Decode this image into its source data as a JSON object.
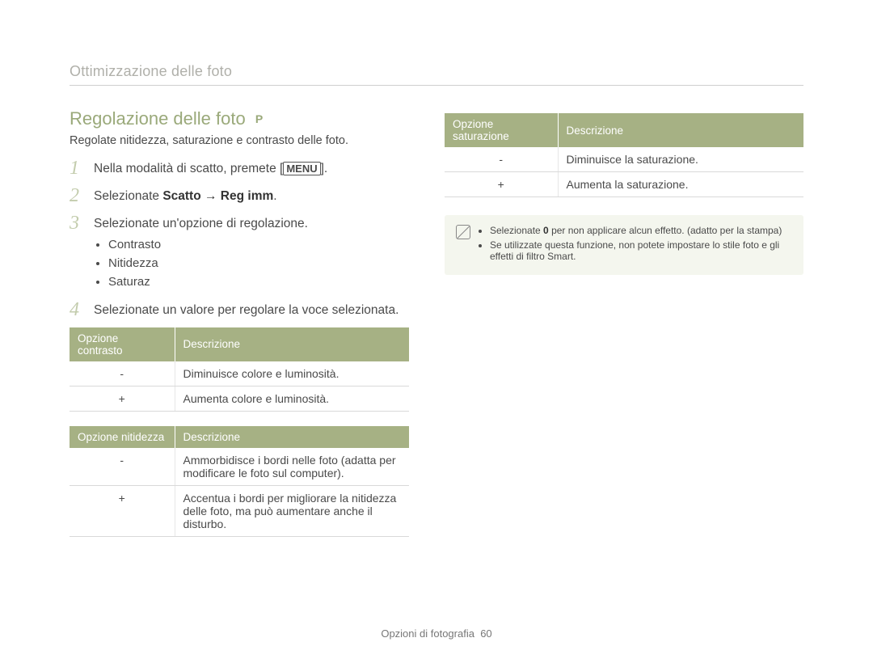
{
  "breadcrumb": "Ottimizzazione delle foto",
  "section": {
    "title": "Regolazione delle foto",
    "mode": "P",
    "intro": "Regolate nitidezza, saturazione e contrasto delle foto."
  },
  "steps": {
    "s1": {
      "num": "1",
      "prefix": "Nella modalità di scatto, premete [",
      "button": "MENU",
      "suffix": "]."
    },
    "s2": {
      "num": "2",
      "prefix": "Selezionate ",
      "bold": "Scatto → Reg imm",
      "suffix": "."
    },
    "s3": {
      "num": "3",
      "text": "Selezionate un'opzione di regolazione.",
      "bullets": [
        "Contrasto",
        "Nitidezza",
        "Saturaz"
      ]
    },
    "s4": {
      "num": "4",
      "text": "Selezionate un valore per regolare la voce selezionata."
    }
  },
  "tables": {
    "contrast": {
      "headers": [
        "Opzione contrasto",
        "Descrizione"
      ],
      "rows": [
        {
          "sym": "-",
          "desc": "Diminuisce colore e luminosità."
        },
        {
          "sym": "+",
          "desc": "Aumenta colore e luminosità."
        }
      ]
    },
    "sharpness": {
      "headers": [
        "Opzione nitidezza",
        "Descrizione"
      ],
      "rows": [
        {
          "sym": "-",
          "desc": "Ammorbidisce i bordi nelle foto (adatta per modificare le foto sul computer)."
        },
        {
          "sym": "+",
          "desc": "Accentua i bordi per migliorare la nitidezza delle foto, ma può aumentare anche il disturbo."
        }
      ]
    },
    "saturation": {
      "headers": [
        "Opzione saturazione",
        "Descrizione"
      ],
      "rows": [
        {
          "sym": "-",
          "desc": "Diminuisce la saturazione."
        },
        {
          "sym": "+",
          "desc": "Aumenta la saturazione."
        }
      ]
    }
  },
  "notes": {
    "n1": {
      "pre": "Selezionate ",
      "bold": "0",
      "post": " per non applicare alcun effetto. (adatto per la stampa)"
    },
    "n2": "Se utilizzate questa funzione, non potete impostare lo stile foto e gli effetti di filtro Smart."
  },
  "footer": {
    "section": "Opzioni di fotografia",
    "page": "60"
  }
}
